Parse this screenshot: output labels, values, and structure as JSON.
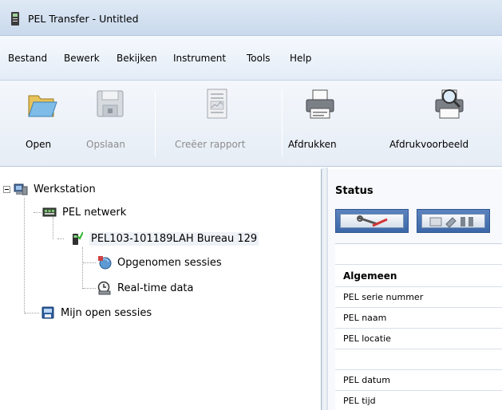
{
  "window": {
    "title": "PEL Transfer - Untitled",
    "icon": "pel-device-icon"
  },
  "menu": {
    "items": [
      {
        "label": "Bestand"
      },
      {
        "label": "Bewerk"
      },
      {
        "label": "Bekijken"
      },
      {
        "label": "Instrument"
      },
      {
        "label": "Tools"
      },
      {
        "label": "Help"
      }
    ]
  },
  "toolbar": {
    "open": {
      "label": "Open",
      "icon": "folder-open-icon",
      "enabled": true
    },
    "save": {
      "label": "Opslaan",
      "icon": "floppy-disk-icon",
      "enabled": false
    },
    "report": {
      "label": "Creëer rapport",
      "icon": "report-document-icon",
      "enabled": false
    },
    "print": {
      "label": "Afdrukken",
      "icon": "printer-icon",
      "enabled": true
    },
    "preview": {
      "label": "Afdrukvoorbeeld",
      "icon": "print-preview-icon",
      "enabled": true
    }
  },
  "tree": {
    "workstation": {
      "label": "Werkstation",
      "icon": "workstation-icon"
    },
    "network": {
      "label": "PEL netwerk",
      "icon": "network-icon"
    },
    "device": {
      "label": "PEL103-101189LAH Bureau 129",
      "icon": "pel-device-icon"
    },
    "recorded": {
      "label": "Opgenomen sessies",
      "icon": "recorded-sessions-icon"
    },
    "realtime": {
      "label": "Real-time data",
      "icon": "realtime-data-icon"
    },
    "open_sessions": {
      "label": "Mijn open sessies",
      "icon": "open-sessions-icon"
    }
  },
  "status": {
    "title": "Status",
    "tabs": [
      {
        "icon": "tools-icon"
      },
      {
        "icon": "instrument-settings-icon"
      }
    ],
    "section": "Algemeen",
    "rows": [
      {
        "label": "PEL serie nummer"
      },
      {
        "label": "PEL naam"
      },
      {
        "label": "PEL locatie"
      },
      {
        "label": ""
      },
      {
        "label": "PEL datum"
      },
      {
        "label": "PEL tijd"
      }
    ]
  }
}
